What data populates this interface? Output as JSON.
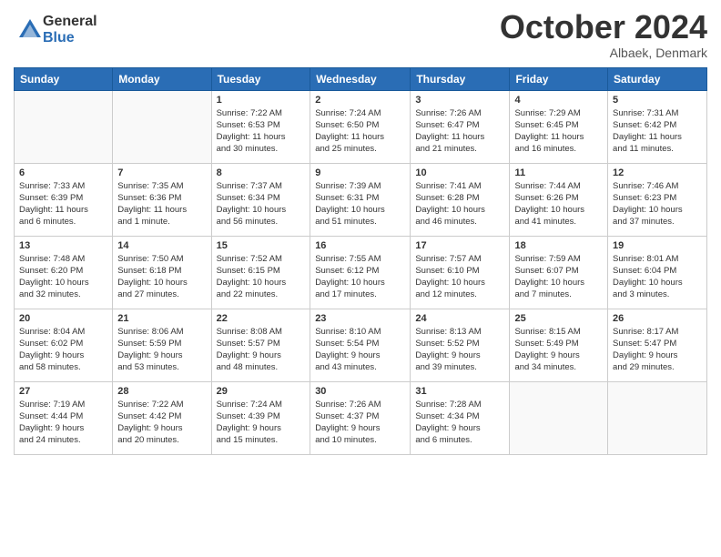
{
  "logo": {
    "general": "General",
    "blue": "Blue"
  },
  "header": {
    "month": "October 2024",
    "location": "Albaek, Denmark"
  },
  "weekdays": [
    "Sunday",
    "Monday",
    "Tuesday",
    "Wednesday",
    "Thursday",
    "Friday",
    "Saturday"
  ],
  "weeks": [
    [
      {
        "day": "",
        "info": ""
      },
      {
        "day": "",
        "info": ""
      },
      {
        "day": "1",
        "info": "Sunrise: 7:22 AM\nSunset: 6:53 PM\nDaylight: 11 hours\nand 30 minutes."
      },
      {
        "day": "2",
        "info": "Sunrise: 7:24 AM\nSunset: 6:50 PM\nDaylight: 11 hours\nand 25 minutes."
      },
      {
        "day": "3",
        "info": "Sunrise: 7:26 AM\nSunset: 6:47 PM\nDaylight: 11 hours\nand 21 minutes."
      },
      {
        "day": "4",
        "info": "Sunrise: 7:29 AM\nSunset: 6:45 PM\nDaylight: 11 hours\nand 16 minutes."
      },
      {
        "day": "5",
        "info": "Sunrise: 7:31 AM\nSunset: 6:42 PM\nDaylight: 11 hours\nand 11 minutes."
      }
    ],
    [
      {
        "day": "6",
        "info": "Sunrise: 7:33 AM\nSunset: 6:39 PM\nDaylight: 11 hours\nand 6 minutes."
      },
      {
        "day": "7",
        "info": "Sunrise: 7:35 AM\nSunset: 6:36 PM\nDaylight: 11 hours\nand 1 minute."
      },
      {
        "day": "8",
        "info": "Sunrise: 7:37 AM\nSunset: 6:34 PM\nDaylight: 10 hours\nand 56 minutes."
      },
      {
        "day": "9",
        "info": "Sunrise: 7:39 AM\nSunset: 6:31 PM\nDaylight: 10 hours\nand 51 minutes."
      },
      {
        "day": "10",
        "info": "Sunrise: 7:41 AM\nSunset: 6:28 PM\nDaylight: 10 hours\nand 46 minutes."
      },
      {
        "day": "11",
        "info": "Sunrise: 7:44 AM\nSunset: 6:26 PM\nDaylight: 10 hours\nand 41 minutes."
      },
      {
        "day": "12",
        "info": "Sunrise: 7:46 AM\nSunset: 6:23 PM\nDaylight: 10 hours\nand 37 minutes."
      }
    ],
    [
      {
        "day": "13",
        "info": "Sunrise: 7:48 AM\nSunset: 6:20 PM\nDaylight: 10 hours\nand 32 minutes."
      },
      {
        "day": "14",
        "info": "Sunrise: 7:50 AM\nSunset: 6:18 PM\nDaylight: 10 hours\nand 27 minutes."
      },
      {
        "day": "15",
        "info": "Sunrise: 7:52 AM\nSunset: 6:15 PM\nDaylight: 10 hours\nand 22 minutes."
      },
      {
        "day": "16",
        "info": "Sunrise: 7:55 AM\nSunset: 6:12 PM\nDaylight: 10 hours\nand 17 minutes."
      },
      {
        "day": "17",
        "info": "Sunrise: 7:57 AM\nSunset: 6:10 PM\nDaylight: 10 hours\nand 12 minutes."
      },
      {
        "day": "18",
        "info": "Sunrise: 7:59 AM\nSunset: 6:07 PM\nDaylight: 10 hours\nand 7 minutes."
      },
      {
        "day": "19",
        "info": "Sunrise: 8:01 AM\nSunset: 6:04 PM\nDaylight: 10 hours\nand 3 minutes."
      }
    ],
    [
      {
        "day": "20",
        "info": "Sunrise: 8:04 AM\nSunset: 6:02 PM\nDaylight: 9 hours\nand 58 minutes."
      },
      {
        "day": "21",
        "info": "Sunrise: 8:06 AM\nSunset: 5:59 PM\nDaylight: 9 hours\nand 53 minutes."
      },
      {
        "day": "22",
        "info": "Sunrise: 8:08 AM\nSunset: 5:57 PM\nDaylight: 9 hours\nand 48 minutes."
      },
      {
        "day": "23",
        "info": "Sunrise: 8:10 AM\nSunset: 5:54 PM\nDaylight: 9 hours\nand 43 minutes."
      },
      {
        "day": "24",
        "info": "Sunrise: 8:13 AM\nSunset: 5:52 PM\nDaylight: 9 hours\nand 39 minutes."
      },
      {
        "day": "25",
        "info": "Sunrise: 8:15 AM\nSunset: 5:49 PM\nDaylight: 9 hours\nand 34 minutes."
      },
      {
        "day": "26",
        "info": "Sunrise: 8:17 AM\nSunset: 5:47 PM\nDaylight: 9 hours\nand 29 minutes."
      }
    ],
    [
      {
        "day": "27",
        "info": "Sunrise: 7:19 AM\nSunset: 4:44 PM\nDaylight: 9 hours\nand 24 minutes."
      },
      {
        "day": "28",
        "info": "Sunrise: 7:22 AM\nSunset: 4:42 PM\nDaylight: 9 hours\nand 20 minutes."
      },
      {
        "day": "29",
        "info": "Sunrise: 7:24 AM\nSunset: 4:39 PM\nDaylight: 9 hours\nand 15 minutes."
      },
      {
        "day": "30",
        "info": "Sunrise: 7:26 AM\nSunset: 4:37 PM\nDaylight: 9 hours\nand 10 minutes."
      },
      {
        "day": "31",
        "info": "Sunrise: 7:28 AM\nSunset: 4:34 PM\nDaylight: 9 hours\nand 6 minutes."
      },
      {
        "day": "",
        "info": ""
      },
      {
        "day": "",
        "info": ""
      }
    ]
  ]
}
